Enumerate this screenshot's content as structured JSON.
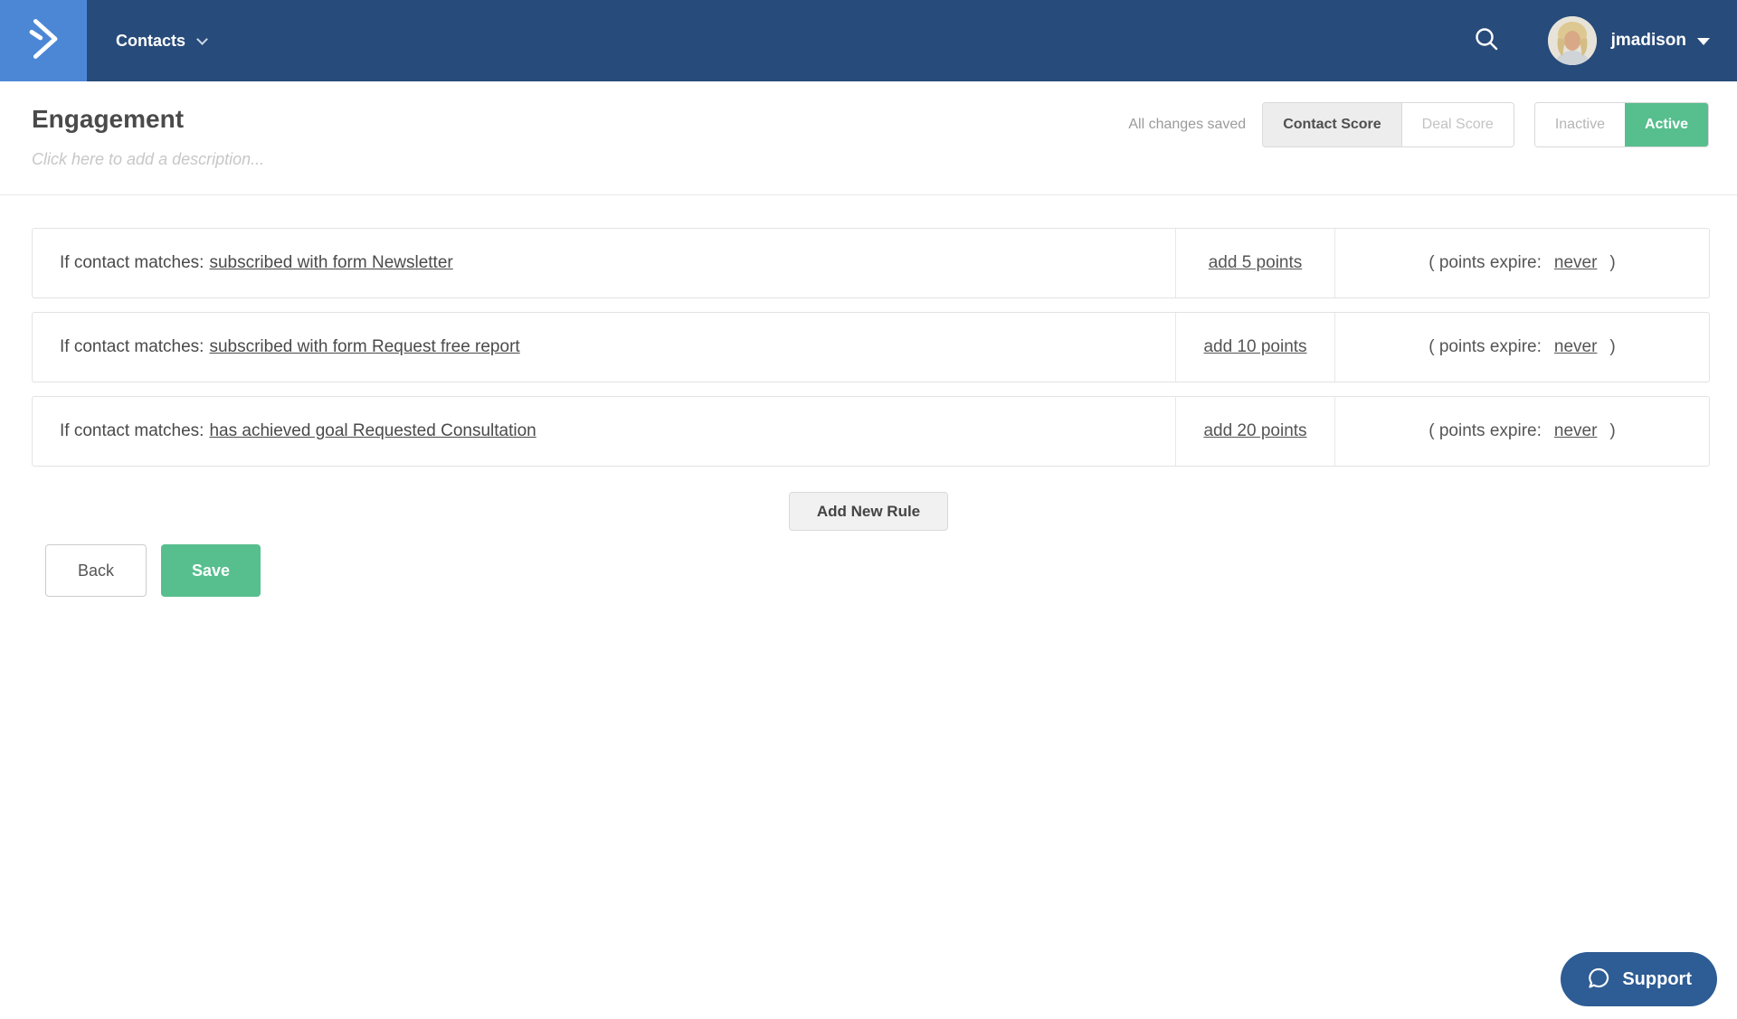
{
  "navbar": {
    "menu_label": "Contacts",
    "username": "jmadison"
  },
  "header": {
    "title": "Engagement",
    "description_placeholder": "Click here to add a description...",
    "save_status": "All changes saved",
    "score_toggle": {
      "options": [
        "Contact Score",
        "Deal Score"
      ],
      "selected": "Contact Score"
    },
    "state_toggle": {
      "options": [
        "Inactive",
        "Active"
      ],
      "selected": "Active"
    }
  },
  "rules": [
    {
      "match_prefix": "If contact matches:",
      "condition": "subscribed with form Newsletter",
      "points": "add 5 points",
      "expire_prefix": "( points expire:",
      "expire_value": "never",
      "expire_close": ")"
    },
    {
      "match_prefix": "If contact matches:",
      "condition": "subscribed with form Request free report",
      "points": "add 10 points",
      "expire_prefix": "( points expire:",
      "expire_value": "never",
      "expire_close": ")"
    },
    {
      "match_prefix": "If contact matches:",
      "condition": "has achieved goal Requested Consultation",
      "points": "add 20 points",
      "expire_prefix": "( points expire:",
      "expire_value": "never",
      "expire_close": ")"
    }
  ],
  "actions": {
    "add_rule": "Add New Rule",
    "back": "Back",
    "save": "Save"
  },
  "support": {
    "label": "Support"
  },
  "icons": {
    "logo": "activecampaign-chevron",
    "search": "magnifier",
    "user_caret": "caret-down",
    "menu_caret": "chevron-down",
    "support": "chat-bubble"
  },
  "colors": {
    "navbar": "#274b7a",
    "logo_tile": "#4c87d6",
    "accent_green": "#57be8e",
    "support_blue": "#2e5c94",
    "row_border": "#e3e3e3",
    "text_dark": "#4a4a4a",
    "muted_gray": "#9b9b9b"
  }
}
